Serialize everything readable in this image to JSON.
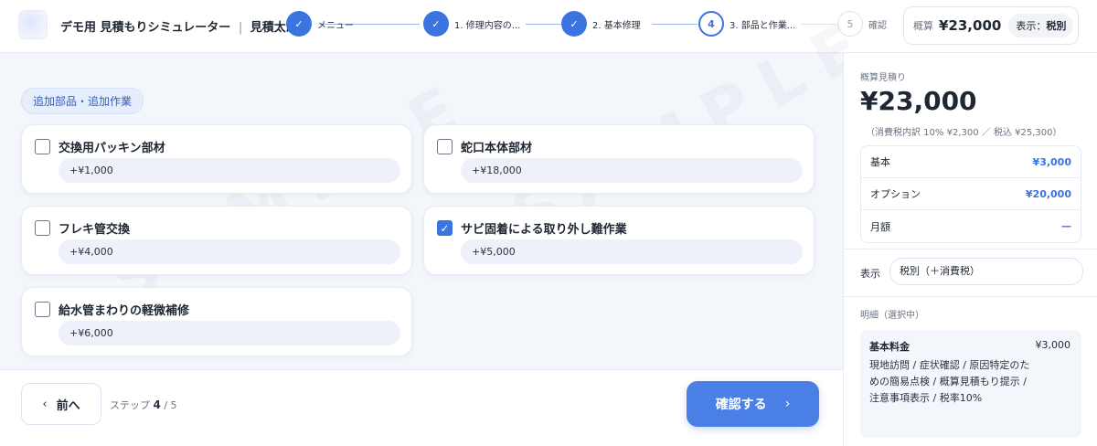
{
  "header": {
    "app_title": "デモ用 見積もりシミュレーター",
    "separator": "|",
    "app_subtitle": "見積太郎",
    "steps": [
      {
        "num": "",
        "label": "メニュー",
        "state": "done"
      },
      {
        "num": "",
        "label": "1. 修理内容の...",
        "state": "done"
      },
      {
        "num": "",
        "label": "2. 基本修理",
        "state": "done"
      },
      {
        "num": "4",
        "label": "3. 部品と作業...",
        "state": "current"
      },
      {
        "num": "5",
        "label": "確認",
        "state": "todo"
      }
    ],
    "summary": {
      "label": "概算",
      "amount": "¥23,000",
      "display_label": "表示：",
      "display_value": "税別"
    }
  },
  "main": {
    "section_tag": "追加部品・追加作業",
    "watermark": "SAMPLE",
    "options": [
      {
        "title": "交換用パッキン部材",
        "price": "+¥1,000",
        "checked": false
      },
      {
        "title": "蛇口本体部材",
        "price": "+¥18,000",
        "checked": false
      },
      {
        "title": "フレキ管交換",
        "price": "+¥4,000",
        "checked": false
      },
      {
        "title": "サビ固着による取り外し難作業",
        "price": "+¥5,000",
        "checked": true
      },
      {
        "title": "給水管まわりの軽微補修",
        "price": "+¥6,000",
        "checked": false
      }
    ]
  },
  "footer": {
    "back_label": "前へ",
    "step_prefix": "ステップ",
    "step_current": "4",
    "step_total": "/ 5",
    "next_label": "確認する"
  },
  "sidebar": {
    "estimate_label": "概算見積り",
    "estimate_amount": "¥23,000",
    "tax_note": "（消費税内訳 10% ¥2,300 ／ 税込 ¥25,300）",
    "rows": [
      {
        "label": "基本",
        "value": "¥3,000"
      },
      {
        "label": "オプション",
        "value": "¥20,000"
      },
      {
        "label": "月額",
        "value": "—"
      }
    ],
    "display_label": "表示",
    "display_value": "税別（＋消費税）",
    "detail_label": "明細（選択中）",
    "detail": {
      "title": "基本料金",
      "price": "¥3,000",
      "description": "現地訪問 / 症状確認 / 原因特定のための簡易点検 / 概算見積もり提示 / 注意事項表示 / 税率10%"
    }
  },
  "colors": {
    "accent": "#3b73e0",
    "background": "#f3f6fb"
  }
}
